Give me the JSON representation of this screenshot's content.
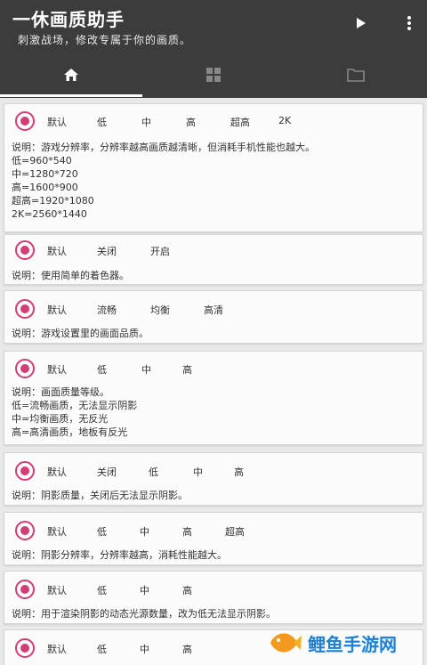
{
  "app": {
    "title": "一休画质助手",
    "subtitle": "刺激战场，修改专属于你的画质。"
  },
  "actions": {
    "play_icon": "play-icon",
    "more_icon": "more-vert-icon"
  },
  "tabs": [
    {
      "icon": "home-icon"
    },
    {
      "icon": "grid-icon"
    },
    {
      "icon": "folder-icon"
    }
  ],
  "cards": [
    {
      "options": [
        "默认",
        "低",
        "中",
        "高",
        "超高",
        "2K"
      ],
      "desc": "说明：游戏分辨率，分辨率越高画质越清晰，但消耗手机性能也越大。\n低=960*540\n中=1280*720\n高=1600*900\n超高=1920*1080\n2K=2560*1440"
    },
    {
      "options": [
        "默认",
        "关闭",
        "开启"
      ],
      "desc": "说明：使用简单的着色器。"
    },
    {
      "options": [
        "默认",
        "流畅",
        "均衡",
        "高清"
      ],
      "desc": "说明：游戏设置里的画面品质。"
    },
    {
      "options": [
        "默认",
        "低",
        "中",
        "高"
      ],
      "desc": "说明：画面质量等级。\n低=流畅画质，无法显示阴影\n中=均衡画质，无反光\n高=高清画质，地板有反光"
    },
    {
      "options": [
        "默认",
        "关闭",
        "低",
        "中",
        "高"
      ],
      "desc": "说明：阴影质量，关闭后无法显示阴影。"
    },
    {
      "options": [
        "默认",
        "低",
        "中",
        "高",
        "超高"
      ],
      "desc": "说明：阴影分辨率，分辨率越高，消耗性能越大。"
    },
    {
      "options": [
        "默认",
        "低",
        "中",
        "高"
      ],
      "desc": "说明：用于渲染阴影的动态光源数量，改为低无法显示阴影。"
    },
    {
      "options": [
        "默认",
        "低",
        "中",
        "高"
      ],
      "desc": ""
    }
  ],
  "watermark": {
    "text": "鲤鱼手游网"
  },
  "colors": {
    "appbar": "#3c3c3c",
    "accent": "#d23d76",
    "watermark": "#1d7fd6"
  }
}
